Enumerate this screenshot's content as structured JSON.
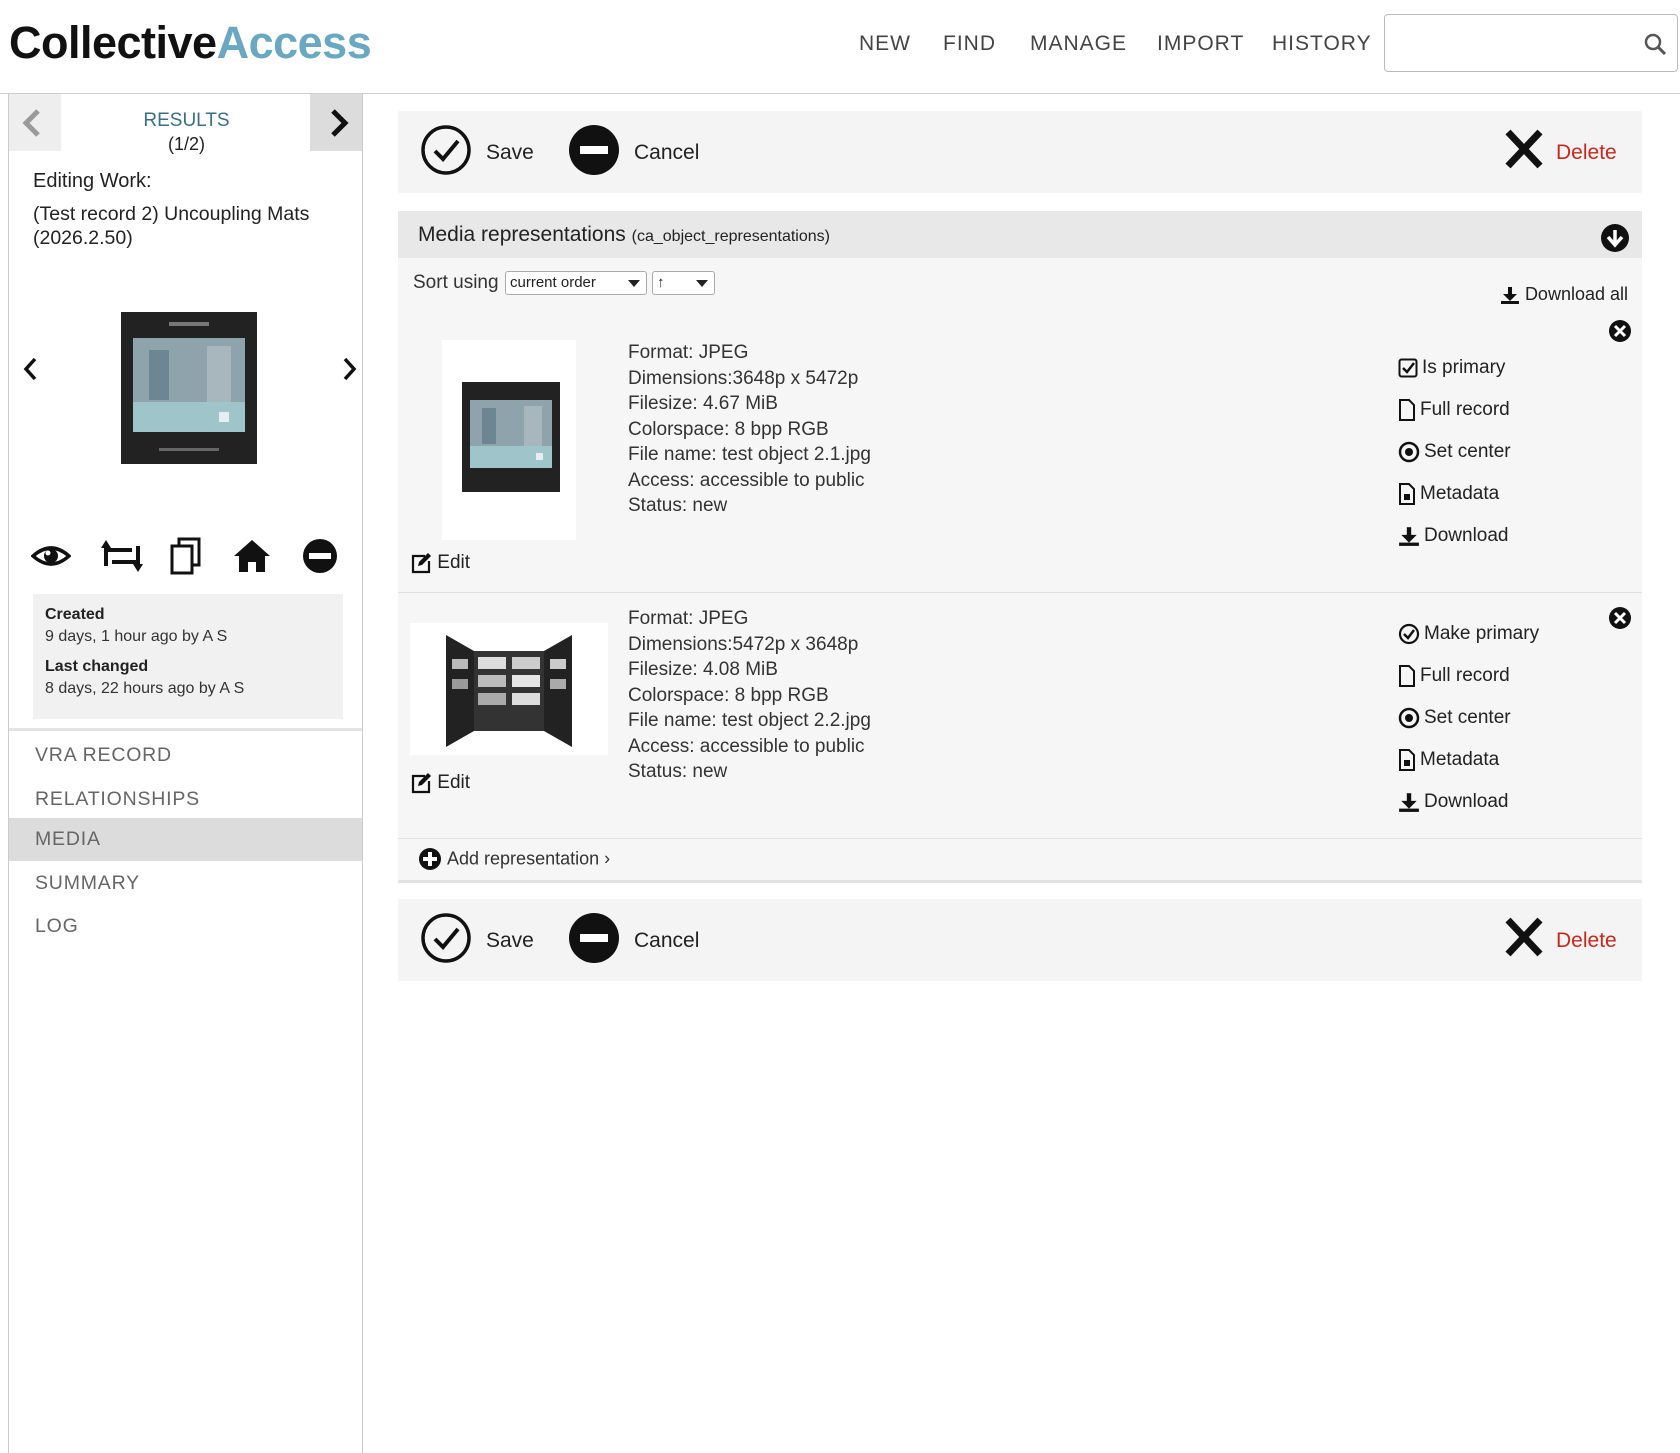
{
  "header": {
    "logo_part1": "Collective",
    "logo_part2": "Access",
    "nav": [
      "NEW",
      "FIND",
      "MANAGE",
      "IMPORT",
      "HISTORY"
    ],
    "search_placeholder": ""
  },
  "sidebar": {
    "results_label": "RESULTS",
    "results_count": "(1/2)",
    "editing_label": "Editing Work:",
    "editing_title": "(Test record 2) Uncoupling Mats (2026.2.50)",
    "created_label": "Created",
    "created_value": "9 days, 1 hour ago by A S",
    "changed_label": "Last changed",
    "changed_value": "8 days, 22 hours ago by A S",
    "items": [
      {
        "label": "VRA RECORD",
        "active": false
      },
      {
        "label": "RELATIONSHIPS",
        "active": false
      },
      {
        "label": "MEDIA",
        "active": true
      },
      {
        "label": "SUMMARY",
        "active": false
      },
      {
        "label": "LOG",
        "active": false
      }
    ]
  },
  "toolbar": {
    "save_label": "Save",
    "cancel_label": "Cancel",
    "delete_label": "Delete"
  },
  "media": {
    "title": "Media representations",
    "subtitle": "(ca_object_representations)",
    "sort_label": "Sort using",
    "sort_value": "current order",
    "sort_dir": "↑",
    "download_all": "Download all",
    "edit_label": "Edit",
    "add_label": "Add representation ›",
    "representations": [
      {
        "format": "Format: JPEG",
        "dimensions": "Dimensions:3648p x 5472p",
        "filesize": "Filesize: 4.67 MiB",
        "colorspace": "Colorspace: 8 bpp RGB",
        "filename": "File name: test object 2.1.jpg",
        "access": "Access: accessible to public",
        "status": "Status: new",
        "primary_label": "Is primary",
        "full_record": "Full record",
        "set_center": "Set center",
        "metadata": "Metadata",
        "download": "Download"
      },
      {
        "format": "Format: JPEG",
        "dimensions": "Dimensions:5472p x 3648p",
        "filesize": "Filesize: 4.08 MiB",
        "colorspace": "Colorspace: 8 bpp RGB",
        "filename": "File name: test object 2.2.jpg",
        "access": "Access: accessible to public",
        "status": "Status: new",
        "primary_label": "Make primary",
        "full_record": "Full record",
        "set_center": "Set center",
        "metadata": "Metadata",
        "download": "Download"
      }
    ]
  },
  "colors": {
    "accent": "#6aa8c1",
    "delete": "#c8281e",
    "results": "#3a6f86"
  }
}
